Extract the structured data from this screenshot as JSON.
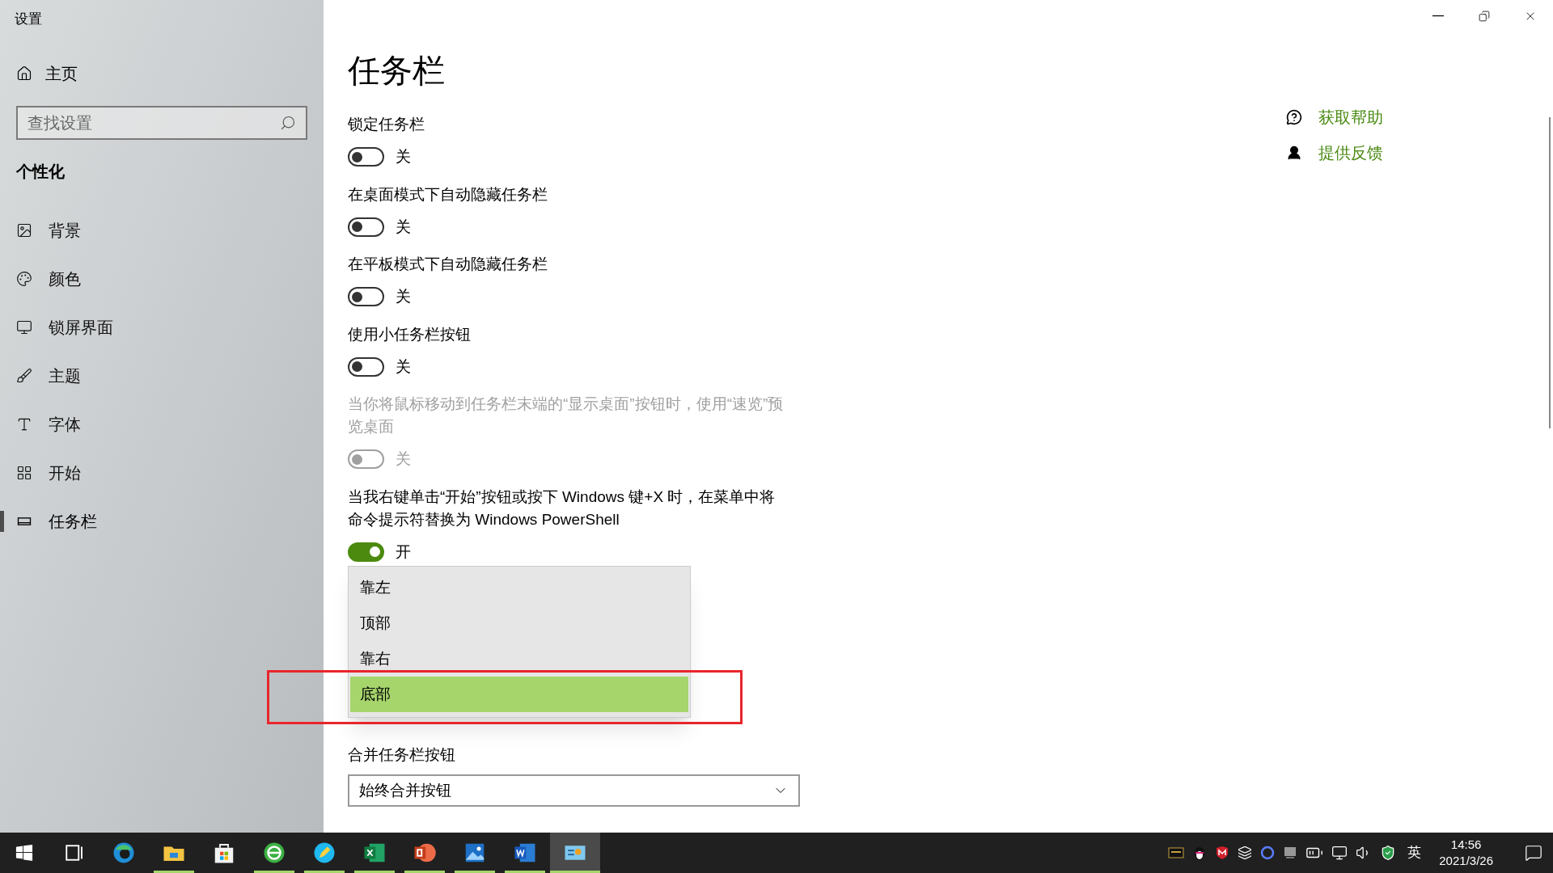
{
  "window": {
    "title": "设置"
  },
  "sidebar": {
    "home": "主页",
    "search": {
      "placeholder": "查找设置"
    },
    "section": "个性化",
    "items": [
      {
        "label": "背景",
        "selected": false
      },
      {
        "label": "颜色",
        "selected": false
      },
      {
        "label": "锁屏界面",
        "selected": false
      },
      {
        "label": "主题",
        "selected": false
      },
      {
        "label": "字体",
        "selected": false
      },
      {
        "label": "开始",
        "selected": false
      },
      {
        "label": "任务栏",
        "selected": true
      }
    ]
  },
  "page": {
    "title": "任务栏",
    "settings": [
      {
        "label": "锁定任务栏",
        "state_text": "关",
        "on": false,
        "disabled": false
      },
      {
        "label": "在桌面模式下自动隐藏任务栏",
        "state_text": "关",
        "on": false,
        "disabled": false
      },
      {
        "label": "在平板模式下自动隐藏任务栏",
        "state_text": "关",
        "on": false,
        "disabled": false
      },
      {
        "label": "使用小任务栏按钮",
        "state_text": "关",
        "on": false,
        "disabled": false
      },
      {
        "label": "当你将鼠标移动到任务栏末端的“显示桌面”按钮时，使用“速览”预览桌面",
        "state_text": "关",
        "on": false,
        "disabled": true
      },
      {
        "label": "当我右键单击“开始”按钮或按下 Windows 键+X 时，在菜单中将命令提示符替换为 Windows PowerShell",
        "state_text": "开",
        "on": true,
        "disabled": false
      }
    ],
    "position_menu": {
      "items": [
        {
          "label": "靠左",
          "selected": false
        },
        {
          "label": "顶部",
          "selected": false
        },
        {
          "label": "靠右",
          "selected": false
        },
        {
          "label": "底部",
          "selected": true
        }
      ]
    },
    "combine": {
      "label": "合并任务栏按钮",
      "value": "始终合并按钮"
    },
    "links": [
      {
        "label": "获取帮助"
      },
      {
        "label": "提供反馈"
      }
    ]
  },
  "taskbar": {
    "apps": [
      {
        "running": false,
        "selected": false
      },
      {
        "running": false,
        "selected": false
      },
      {
        "running": true,
        "selected": false
      },
      {
        "running": false,
        "selected": false
      },
      {
        "running": true,
        "selected": false
      },
      {
        "running": true,
        "selected": false
      },
      {
        "running": true,
        "selected": false
      },
      {
        "running": true,
        "selected": false
      },
      {
        "running": true,
        "selected": false
      },
      {
        "running": true,
        "selected": false
      },
      {
        "running": true,
        "selected": true
      }
    ],
    "tray": {
      "ime": "英",
      "time": "14:56",
      "date": "2021/3/26"
    }
  }
}
